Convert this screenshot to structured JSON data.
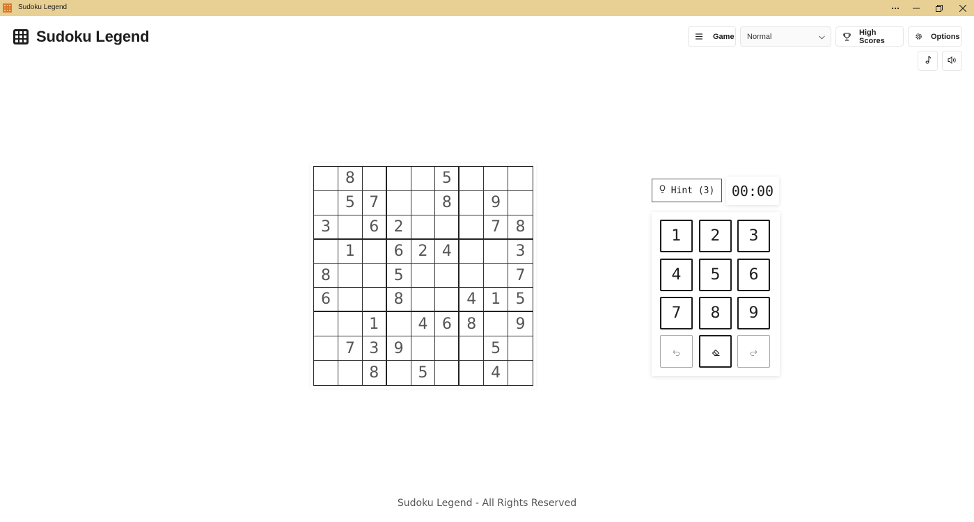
{
  "window": {
    "title": "Sudoku Legend"
  },
  "header": {
    "brand": "Sudoku Legend",
    "game_label": "Game",
    "difficulty": "Normal",
    "high_scores_label": "High Scores",
    "options_label": "Options"
  },
  "board": [
    [
      "",
      "8",
      "",
      "",
      "",
      "5",
      "",
      "",
      ""
    ],
    [
      "",
      "5",
      "7",
      "",
      "",
      "8",
      "",
      "9",
      ""
    ],
    [
      "3",
      "",
      "6",
      "2",
      "",
      "",
      "",
      "7",
      "8"
    ],
    [
      "",
      "1",
      "",
      "6",
      "2",
      "4",
      "",
      "",
      "3"
    ],
    [
      "8",
      "",
      "",
      "5",
      "",
      "",
      "",
      "",
      "7"
    ],
    [
      "6",
      "",
      "",
      "8",
      "",
      "",
      "4",
      "1",
      "5"
    ],
    [
      "",
      "",
      "1",
      "",
      "4",
      "6",
      "8",
      "",
      "9"
    ],
    [
      "",
      "7",
      "3",
      "9",
      "",
      "",
      "",
      "5",
      ""
    ],
    [
      "",
      "",
      "8",
      "",
      "5",
      "",
      "",
      "4",
      ""
    ]
  ],
  "controls": {
    "hint_label": "Hint (3)",
    "timer": "00:00",
    "keys": [
      "1",
      "2",
      "3",
      "4",
      "5",
      "6",
      "7",
      "8",
      "9"
    ]
  },
  "footer": "Sudoku Legend - All Rights Reserved",
  "colors": {
    "titlebar": "#e8d094",
    "app_icon": "#d9772b"
  }
}
